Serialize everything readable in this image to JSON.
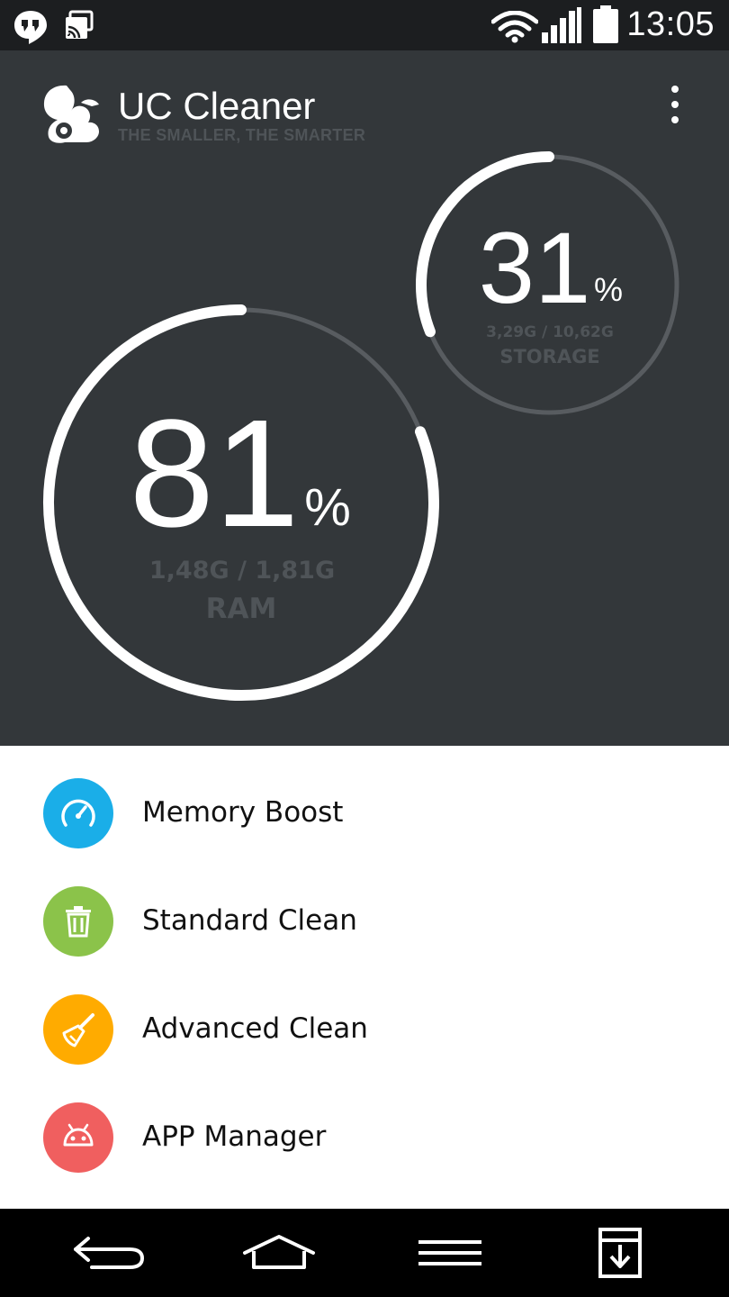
{
  "status_bar": {
    "time": "13:05",
    "icons": [
      "hangouts-icon",
      "cast-icon",
      "wifi-icon",
      "signal-icon",
      "battery-icon"
    ]
  },
  "app": {
    "title": "UC Cleaner",
    "subtitle": "THE SMALLER, THE SMARTER",
    "logo": "squirrel-logo"
  },
  "ram": {
    "percent": "81",
    "percent_sign": "%",
    "usage": "1,48G / 1,81G",
    "label": "RAM",
    "fraction": 0.81
  },
  "storage": {
    "percent": "31",
    "percent_sign": "%",
    "usage": "3,29G / 10,62G",
    "label": "STORAGE",
    "fraction": 0.31
  },
  "menu": {
    "items": [
      {
        "label": "Memory Boost",
        "icon": "speedometer-icon",
        "color": "#1aaee8"
      },
      {
        "label": "Standard Clean",
        "icon": "trash-icon",
        "color": "#8bc34a"
      },
      {
        "label": "Advanced Clean",
        "icon": "broom-icon",
        "color": "#ffab00"
      },
      {
        "label": "APP Manager",
        "icon": "android-icon",
        "color": "#f05f5f"
      }
    ]
  },
  "colors": {
    "header_bg": "#33373a",
    "ring_active": "#ffffff",
    "ring_track": "#585c60",
    "muted_text": "#4f5458"
  },
  "nav_bar": {
    "buttons": [
      "back-icon",
      "home-icon",
      "menu-icon",
      "download-icon"
    ]
  }
}
